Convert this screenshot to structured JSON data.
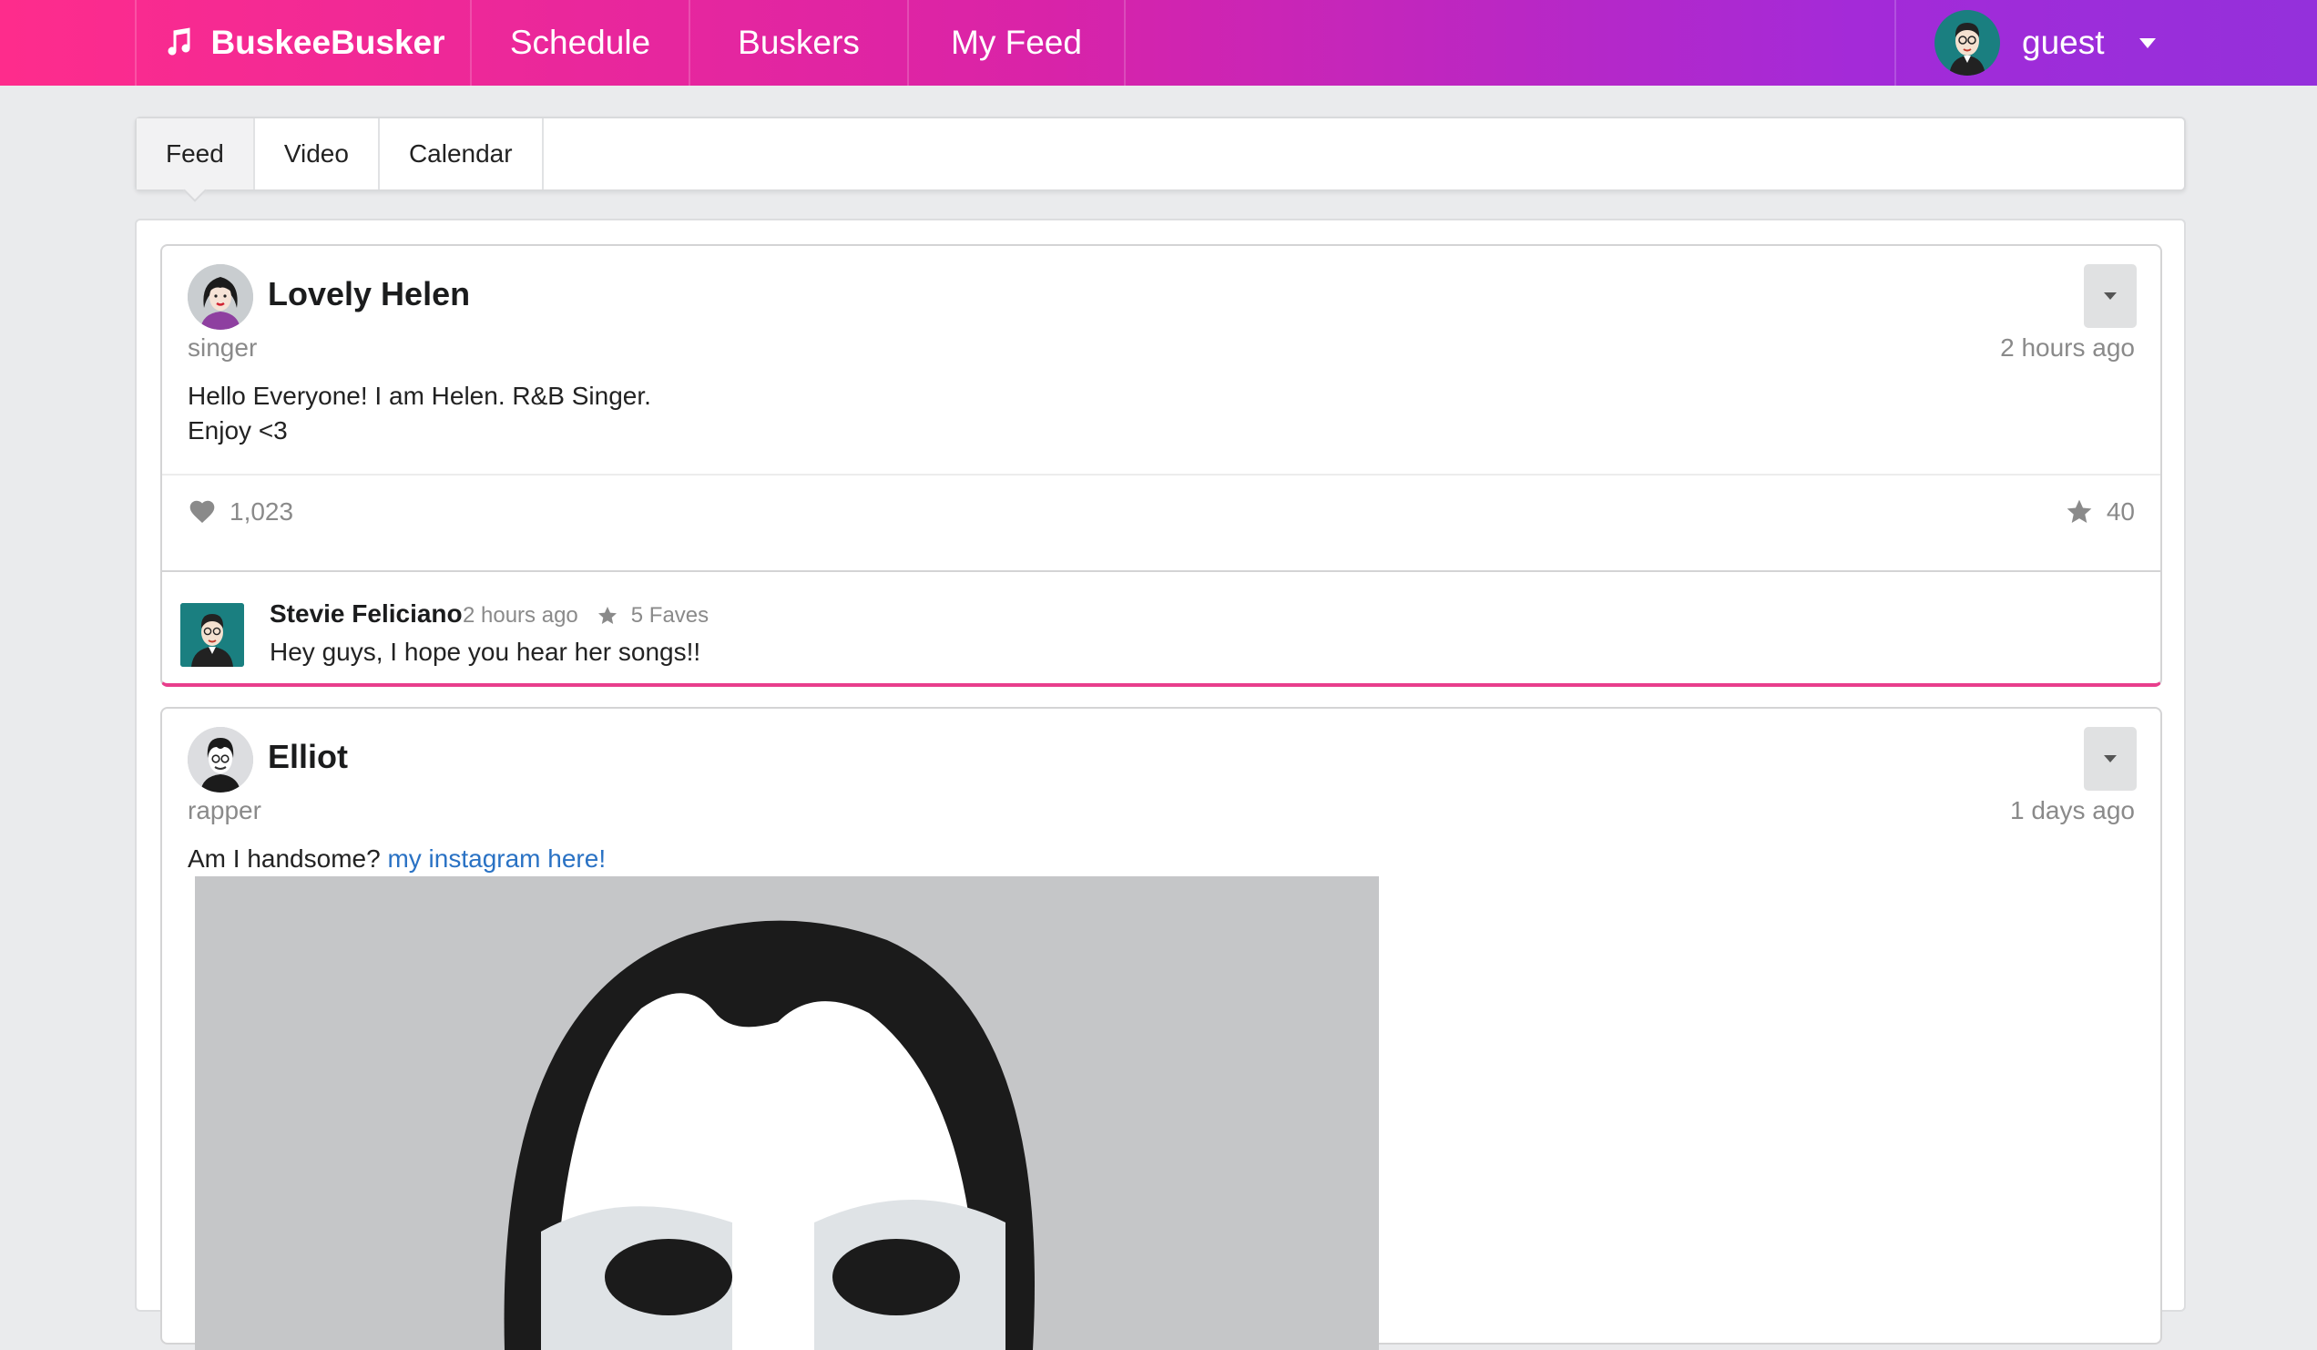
{
  "nav": {
    "brand": "BuskeeBusker",
    "items": [
      {
        "label": "Schedule"
      },
      {
        "label": "Buskers"
      },
      {
        "label": "My Feed"
      }
    ],
    "user": {
      "name": "guest"
    }
  },
  "tabs": [
    {
      "label": "Feed",
      "active": true
    },
    {
      "label": "Video",
      "active": false
    },
    {
      "label": "Calendar",
      "active": false
    }
  ],
  "posts": [
    {
      "author": "Lovely Helen",
      "role": "singer",
      "time": "2 hours ago",
      "body_line1": "Hello Everyone! I am Helen. R&B Singer.",
      "body_line2": "Enjoy <3",
      "likes": "1,023",
      "faves": "40",
      "comment": {
        "author": "Stevie Feliciano",
        "time": "2 hours ago",
        "faves": "5 Faves",
        "text": "Hey guys, I hope you hear her songs!!"
      }
    },
    {
      "author": "Elliot",
      "role": "rapper",
      "time": "1 days ago",
      "body_text": "Am I handsome?",
      "body_link": "my instagram here!"
    }
  ],
  "colors": {
    "nav_gradient_start": "#fe2c8c",
    "nav_gradient_end": "#9430db",
    "card_accent": "#e83e8c",
    "link": "#2a72c4"
  },
  "icons": {
    "brand": "music-note-icon",
    "user_caret": "caret-down-icon",
    "post_menu": "caret-down-icon",
    "like": "heart-icon",
    "fave": "star-icon"
  }
}
